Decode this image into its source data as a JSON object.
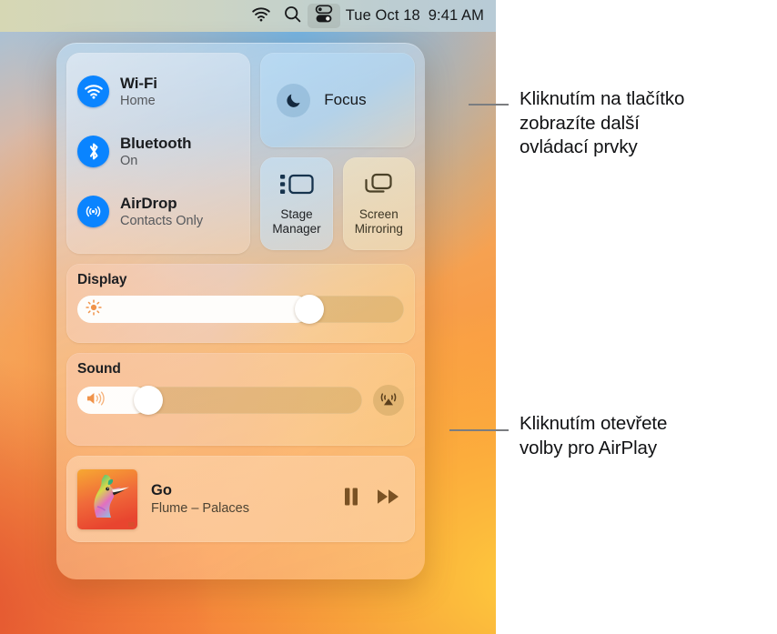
{
  "menubar": {
    "icons": [
      {
        "name": "wifi-icon",
        "label": "Wi-Fi"
      },
      {
        "name": "search-icon",
        "label": "Spotlight Search"
      },
      {
        "name": "control-center-icon",
        "label": "Control Center"
      }
    ],
    "date": "Tue Oct 18",
    "time": "9:41 AM"
  },
  "control_center": {
    "connectivity": [
      {
        "icon": "wifi-icon",
        "title": "Wi-Fi",
        "status": "Home"
      },
      {
        "icon": "bluetooth-icon",
        "title": "Bluetooth",
        "status": "On"
      },
      {
        "icon": "airdrop-icon",
        "title": "AirDrop",
        "status": "Contacts Only"
      }
    ],
    "focus": {
      "icon": "moon-icon",
      "label": "Focus"
    },
    "small_tiles": [
      {
        "icon": "stage-manager-icon",
        "label": "Stage\nManager",
        "line1": "Stage",
        "line2": "Manager"
      },
      {
        "icon": "screen-mirroring-icon",
        "label": "Screen\nMirroring",
        "line1": "Screen",
        "line2": "Mirroring"
      }
    ],
    "display": {
      "title": "Display",
      "icon": "brightness-icon",
      "value_percent": 73
    },
    "sound": {
      "title": "Sound",
      "icon": "volume-icon",
      "value_percent": 22,
      "airplay_icon": "airplay-icon"
    },
    "now_playing": {
      "artwork": "album-artwork-palaces",
      "title": "Go",
      "subtitle": "Flume – Palaces",
      "controls": [
        {
          "name": "pause-button",
          "icon": "pause-icon"
        },
        {
          "name": "fast-forward-button",
          "icon": "fast-forward-icon"
        }
      ]
    }
  },
  "callouts": [
    {
      "id": "callout-control-center-button",
      "lines": [
        "Kliknutím na tlačítko",
        "zobrazíte další",
        "ovládací prvky"
      ]
    },
    {
      "id": "callout-airplay",
      "lines": [
        "Kliknutím otevřete",
        "volby pro AirPlay"
      ]
    }
  ],
  "colors": {
    "accent_blue": "#0a84ff",
    "leader_line": "#7b7d80",
    "text_primary": "#1b1d20",
    "text_secondary": "#55585c"
  }
}
